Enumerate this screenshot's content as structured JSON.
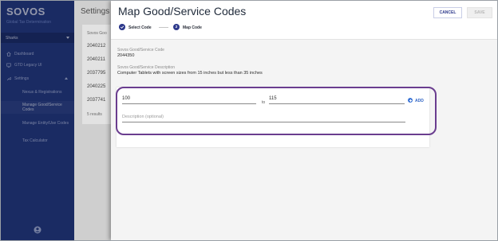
{
  "sidebar": {
    "brand": "SOVOS",
    "subtitle": "Global Tax Determination",
    "org": "Sharks",
    "items": [
      {
        "label": "Dashboard",
        "icon": "home-icon"
      },
      {
        "label": "GTD Legacy UI",
        "icon": "monitor-icon"
      },
      {
        "label": "Settings",
        "icon": "wrench-icon"
      },
      {
        "label": "Nexus & Registrations"
      },
      {
        "label": "Manage Good/Service Codes"
      },
      {
        "label": "Manage Entity/Use Codes"
      },
      {
        "label": "Tax Calculator"
      }
    ],
    "account_icon": "account-circle-icon"
  },
  "background": {
    "title": "Settings",
    "column_header": "Sovos Goo",
    "rows": [
      "2040212",
      "2040211",
      "2037795",
      "2040225",
      "2037741"
    ],
    "footer": "5 results"
  },
  "modal": {
    "title": "Map Good/Service Codes",
    "cancel_label": "CANCEL",
    "save_label": "SAVE",
    "steps": [
      {
        "label": "Select Code"
      },
      {
        "number": "2",
        "label": "Map Code"
      }
    ],
    "code_label": "Sovos Good/Service Code",
    "code_value": "2044350",
    "desc_label": "Sovos Good/Service Description",
    "desc_value": "Computer Tablets with screen sizes from 15 inches but less than 35 inches",
    "range": {
      "from_value": "100",
      "to_label": "to",
      "to_value": "115",
      "add_label": "ADD",
      "description_placeholder": "Description (optional)"
    }
  },
  "colors": {
    "sidebar": "#243a82",
    "primary": "#2e3a8c",
    "highlight_outline": "#6a3d8f",
    "add_blue": "#2e63c4"
  }
}
